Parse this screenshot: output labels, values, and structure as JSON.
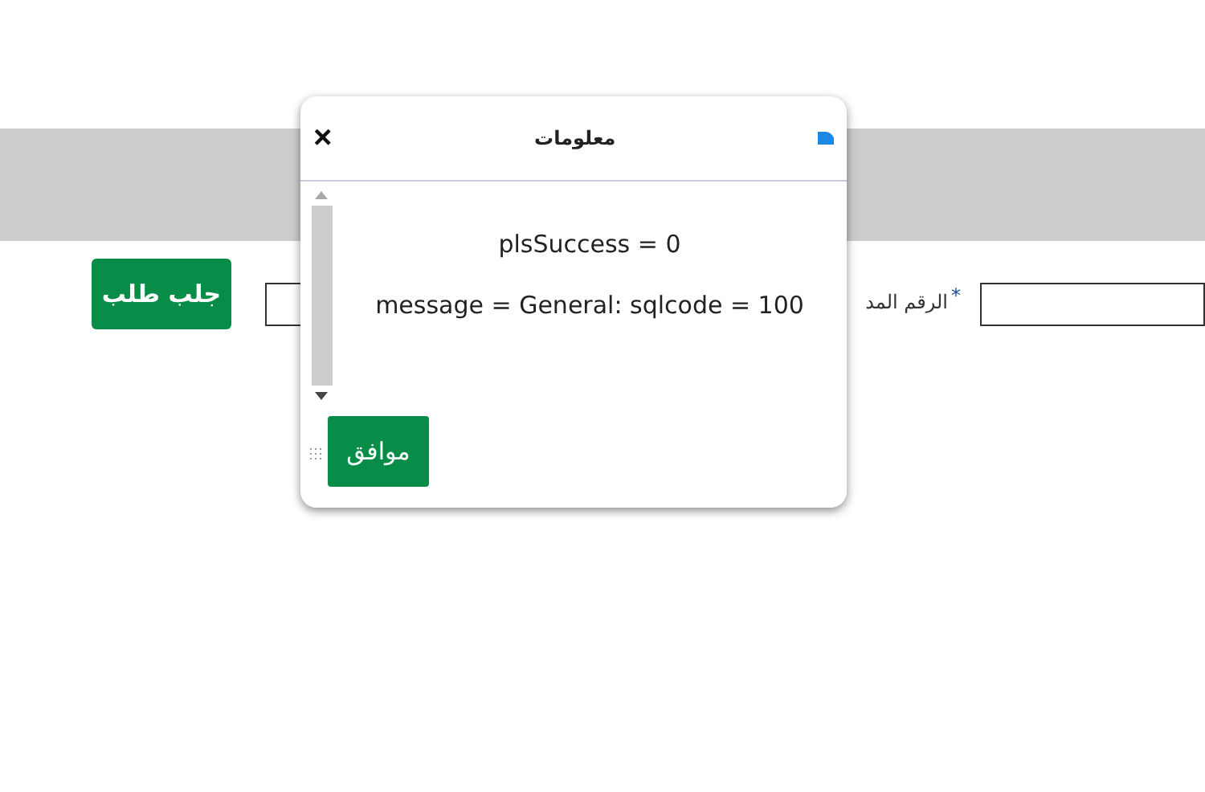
{
  "form": {
    "fetch_button": "جلب طلب",
    "field_label": "الرقم المد",
    "required_mark": "*"
  },
  "dialog": {
    "title": "معلومات",
    "close": "×",
    "lines": [
      "plsSuccess = 0",
      "message = General: sqlcode = 100"
    ],
    "ok_button": "موافق"
  }
}
